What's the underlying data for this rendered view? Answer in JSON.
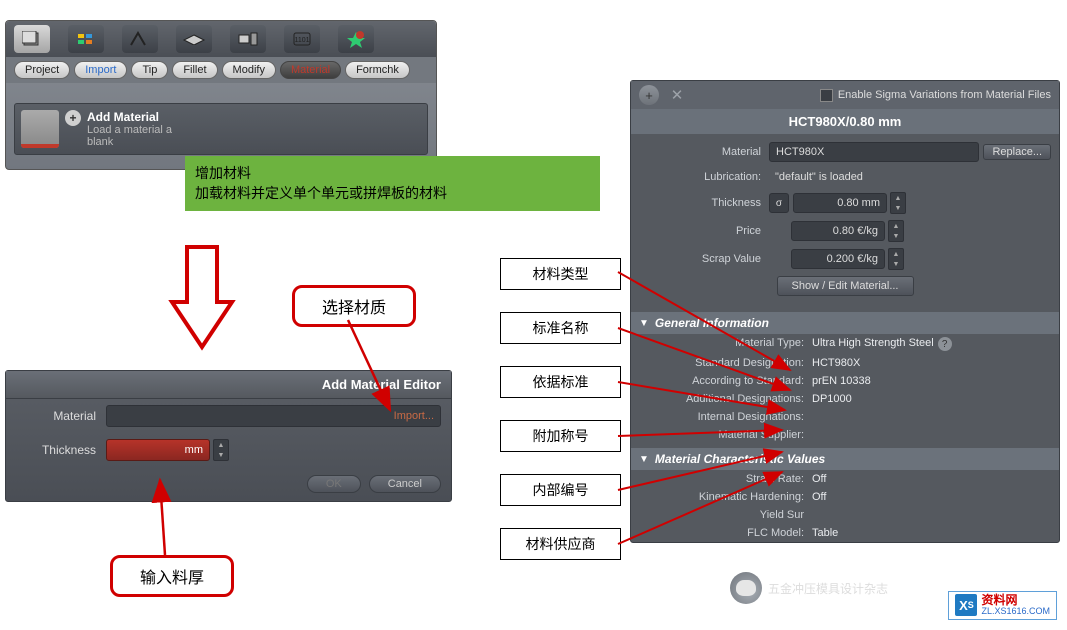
{
  "toolbar": {
    "tabs": {
      "project": "Project",
      "import": "Import",
      "tip": "Tip",
      "fillet": "Fillet",
      "modify": "Modify",
      "material": "Material",
      "formchk": "Formchk"
    },
    "add_material": {
      "title": "Add Material",
      "sub1": "Load a material a",
      "sub2": "blank"
    }
  },
  "green_callout": {
    "line1": "增加材料",
    "line2": "加载材料并定义单个单元或拼焊板的材料"
  },
  "select_material_callout": "选择材质",
  "input_thickness_callout": "输入料厚",
  "editor": {
    "title": "Add Material Editor",
    "material_label": "Material",
    "material_value": "",
    "import_link": "Import...",
    "thickness_label": "Thickness",
    "thickness_value": "",
    "thickness_unit": "mm",
    "ok": "OK",
    "cancel": "Cancel"
  },
  "labels": {
    "material_type": "材料类型",
    "std_name": "标准名称",
    "according_std": "依据标准",
    "additional_des": "附加称号",
    "internal_code": "内部编号",
    "supplier": "材料供应商"
  },
  "right": {
    "enable_text": "Enable Sigma Variations from Material Files",
    "title": "HCT980X/0.80 mm",
    "material_label": "Material",
    "material_value": "HCT980X",
    "replace": "Replace...",
    "lubrication_label": "Lubrication:",
    "lubrication_value": "\"default\" is loaded",
    "thickness_label": "Thickness",
    "thickness_value": "0.80 mm",
    "price_label": "Price",
    "price_value": "0.80 €/kg",
    "scrap_label": "Scrap Value",
    "scrap_value": "0.200 €/kg",
    "show_edit": "Show / Edit Material...",
    "general_header": "General Information",
    "gen": {
      "material_type_label": "Material Type:",
      "material_type_value": "Ultra High Strength Steel",
      "std_designation_label": "Standard Designation:",
      "std_designation_value": "HCT980X",
      "according_label": "According to Standard:",
      "according_value": "prEN 10338",
      "additional_label": "Additional Designations:",
      "additional_value": "DP1000",
      "internal_label": "Internal Designations:",
      "internal_value": "",
      "supplier_label": "Material Supplier:",
      "supplier_value": ""
    },
    "char_header": "Material Characteristic Values",
    "char": {
      "strain_label": "Strain Rate:",
      "strain_value": "Off",
      "kin_label": "Kinematic Hardening:",
      "kin_value": "Off",
      "yield_label": "Yield Sur",
      "yield_value": "",
      "flc_label": "FLC Model:",
      "flc_value": "Table"
    }
  },
  "wechat_text": "五金冲压模具设计杂志",
  "zl_logo": {
    "big": "资料网",
    "url": "ZL.XS1616.COM"
  }
}
